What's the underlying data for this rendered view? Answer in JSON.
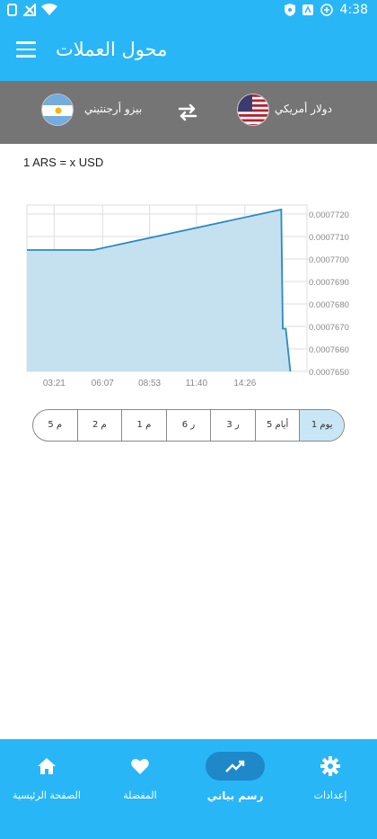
{
  "status_bar": {
    "time": "4:38"
  },
  "app_bar": {
    "title": "محول العملات",
    "menu_icon": "menu-icon"
  },
  "currency": {
    "from_label": "بيزو أرجنتيني",
    "to_label": "دولار أمريكي",
    "from_flag": "argentina-flag",
    "to_flag": "usa-flag",
    "swap_icon": "swap-icon"
  },
  "rate_text": "1 ARS = x USD",
  "chart_data": {
    "type": "area",
    "x_ticks": [
      "03:21",
      "06:07",
      "08:53",
      "11:40",
      "14:26"
    ],
    "y_ticks": [
      "0.0007650",
      "0.0007660",
      "0.0007670",
      "0.0007680",
      "0.0007690",
      "0.0007700",
      "0.0007710",
      "0.0007720"
    ],
    "ylim": [
      0.000765,
      0.0007724
    ],
    "x_hours": [
      1.0,
      4.4,
      16.8,
      16.9,
      17.1,
      17.4
    ],
    "series": [
      {
        "values": [
          0.0007704,
          0.0007704,
          0.0007722,
          0.0007669,
          0.0007669,
          0.000765
        ]
      }
    ],
    "line_color": "#2a8ac2",
    "fill_color": "#c5e1f0",
    "grid": true
  },
  "ranges": [
    {
      "label": "1 يوم",
      "active": true
    },
    {
      "label": "5 أيام",
      "active": false
    },
    {
      "label": "3 ر",
      "active": false
    },
    {
      "label": "6 ر",
      "active": false
    },
    {
      "label": "1 م",
      "active": false
    },
    {
      "label": "2 م",
      "active": false
    },
    {
      "label": "5 م",
      "active": false
    }
  ],
  "bottom_nav": {
    "home": "الصفحة الرئيسية",
    "favorites": "المفضلة",
    "chart": "رسم بياني",
    "settings": "إعدادات"
  },
  "colors": {
    "primary": "#29b6f6",
    "currency_bar": "#757575"
  }
}
